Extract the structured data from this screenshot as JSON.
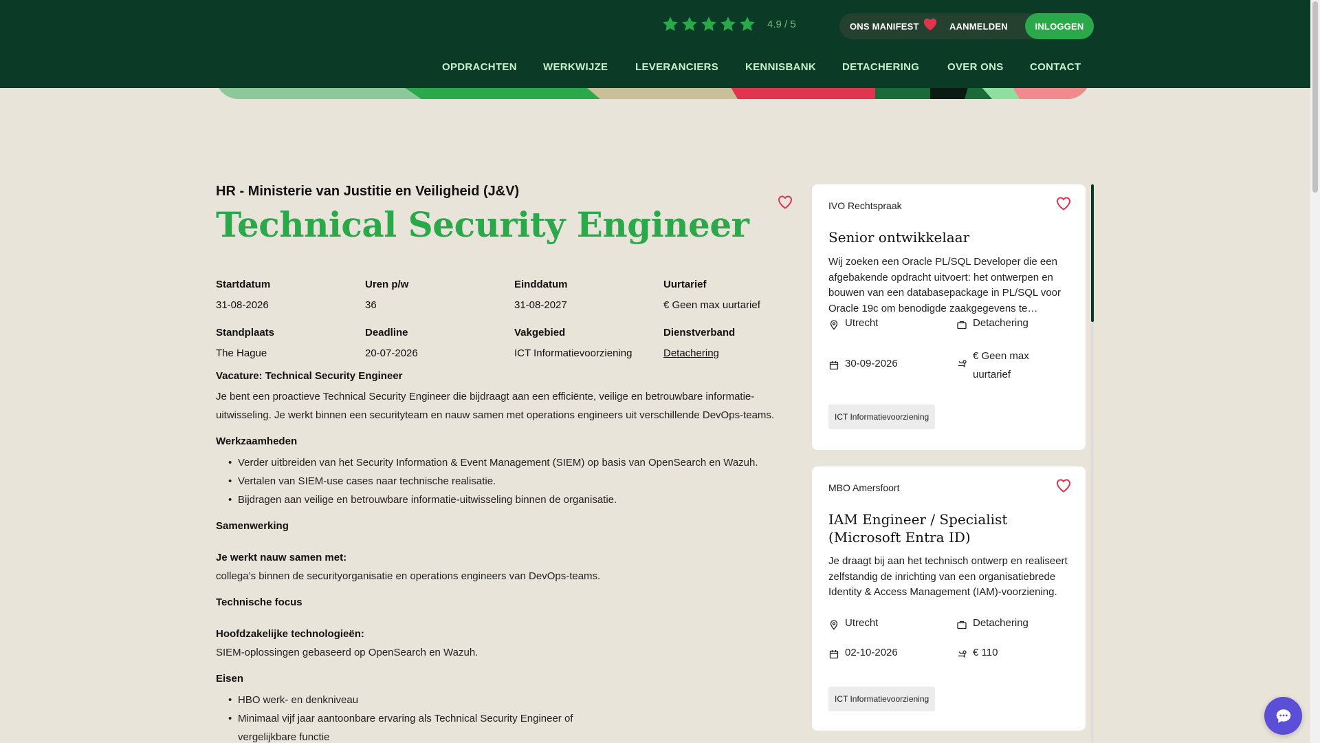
{
  "header": {
    "rating_text": "4.9 / 5",
    "rating_stars": 5,
    "manifest": "ONS MANIFEST",
    "signup": "AANMELDEN",
    "login": "INLOGGEN",
    "nav": [
      "OPDRACHTEN",
      "WERKWIJZE",
      "LEVERANCIERS",
      "KENNISBANK",
      "DETACHERING",
      "OVER ONS",
      "CONTACT"
    ]
  },
  "job": {
    "org": "HR - Ministerie van Justitie en Veiligheid (J&V)",
    "title": "Technical Security Engineer",
    "meta": [
      {
        "label": "Startdatum",
        "value": "31-08-2026"
      },
      {
        "label": "Uren p/w",
        "value": "36"
      },
      {
        "label": "Einddatum",
        "value": "31-08-2027"
      },
      {
        "label": "Uurtarief",
        "value": "€ Geen max uurtarief"
      },
      {
        "label": "Standplaats",
        "value": "The Hague"
      },
      {
        "label": "Deadline",
        "value": "20-07-2026"
      },
      {
        "label": "Vakgebied",
        "value": "ICT Informatievoorziening"
      },
      {
        "label": "Dienstverband",
        "value": "Detachering"
      }
    ],
    "vacancy_heading": "Vacature: Technical Security Engineer",
    "intro": "Je bent een proactieve Technical Security Engineer die bijdraagt aan een efficiënte, veilige en betrouwbare informatie-uitwisseling. Je werkt binnen een securityteam en nauw samen met operations engineers uit verschillende DevOps-teams.",
    "werkzaamheden_heading": "Werkzaamheden",
    "werkzaamheden": [
      "Verder uitbreiden van het Security Information & Event Management (SIEM) op basis van OpenSearch en Wazuh.",
      "Vertalen van SIEM-use cases naar technische realisatie.",
      "Bijdragen aan veilige en betrouwbare informatie-uitwisseling binnen de organisatie."
    ],
    "samenwerking_heading": "Samenwerking",
    "samen_subheading": "Je werkt nauw samen met:",
    "samen_text": "collega’s binnen de securityorganisatie en operations engineers van DevOps-teams.",
    "tech_heading": "Technische focus",
    "tech_subheading": "Hoofdzakelijke technologieën:",
    "tech_text": "SIEM-oplossingen gebaseerd op OpenSearch en Wazuh.",
    "eisen_heading": "Eisen",
    "eisen": [
      "HBO werk- en denkniveau",
      "Minimaal vijf jaar aantoonbare ervaring als Technical Security Engineer of vergelijkbare functie"
    ]
  },
  "cards": [
    {
      "org": "IVO Rechtspraak",
      "title": "Senior ontwikkelaar",
      "desc": "Wij zoeken een Oracle PL/SQL Developer die een afgebakende opdracht uitvoert: het ontwerpen en bouwen van een databasepackage in PL/SQL voor Oracle 19c om benodigde zaakgegevens te…",
      "location": "Utrecht",
      "type": "Detachering",
      "date": "30-09-2026",
      "rate": "€ Geen max uurtarief",
      "tag": "ICT Informatievoorziening"
    },
    {
      "org": "MBO Amersfoort",
      "title": "IAM Engineer / Specialist (Microsoft Entra ID)",
      "desc": "Je draagt bij aan het technisch ontwerp en realiseert zelfstandig de inrichting van een organisatiebrede Identity & Access Management (IAM)-voorziening.",
      "location": "Utrecht",
      "type": "Detachering",
      "date": "02-10-2026",
      "rate": "€ 110",
      "tag": "ICT Informatievoorziening"
    }
  ],
  "colors": {
    "header_bg": "#0b3a26",
    "accent_green": "#2aa84a",
    "page_bg": "#e9e4da",
    "heart_red": "#e0344f",
    "chat_purple": "#5a4fd6"
  },
  "icons": {
    "rating": "star-icon",
    "manifest": "heart-icon",
    "favorite": "heart-outline-icon",
    "location": "location-pin-icon",
    "type": "briefcase-icon",
    "date": "calendar-icon",
    "rate": "coins-icon",
    "chat": "chat-bubble-icon"
  }
}
